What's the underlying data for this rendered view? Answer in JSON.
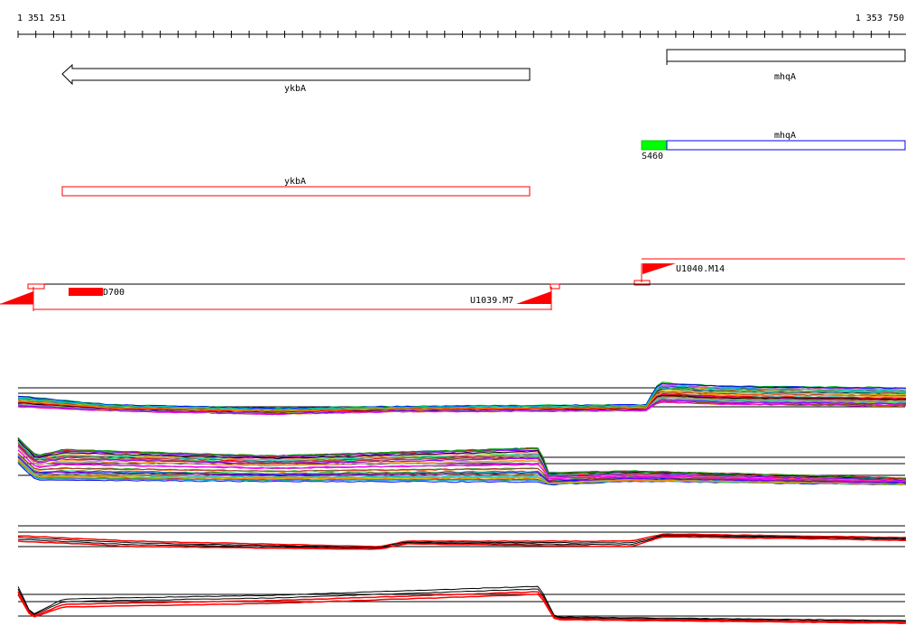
{
  "ruler": {
    "start_label": "1 351 251",
    "end_label": "1 353 750"
  },
  "genes": {
    "ykbA": {
      "name": "ykbA",
      "strand": "minus"
    },
    "mhqA": {
      "name": "mhqA",
      "strand": "plus"
    }
  },
  "cds_track": {
    "ykbA_label": "ykbA",
    "mhqA_label": "mhqA",
    "s460_label": "S460"
  },
  "features": {
    "d700_label": "D700",
    "u1039_label": "U1039.M7",
    "u1040_label": "U1040.M14"
  },
  "colors": {
    "gene_outline": "#000000",
    "cds_ykbA": "#ff0000",
    "cds_mhqA": "#0000ff",
    "s460_fill": "#00ff00",
    "feature_fill": "#ff0000",
    "trace_black": "#000000",
    "trace_red": "#ff0000",
    "trace_palette": [
      "#ff0000",
      "#00aa00",
      "#0000ff",
      "#ff00ff",
      "#00cccc",
      "#cccc00",
      "#ff8800",
      "#8800ff",
      "#00ff88",
      "#884400",
      "#ff66aa",
      "#6666ff",
      "#33aa33",
      "#aa3333",
      "#999999",
      "#000000"
    ]
  }
}
